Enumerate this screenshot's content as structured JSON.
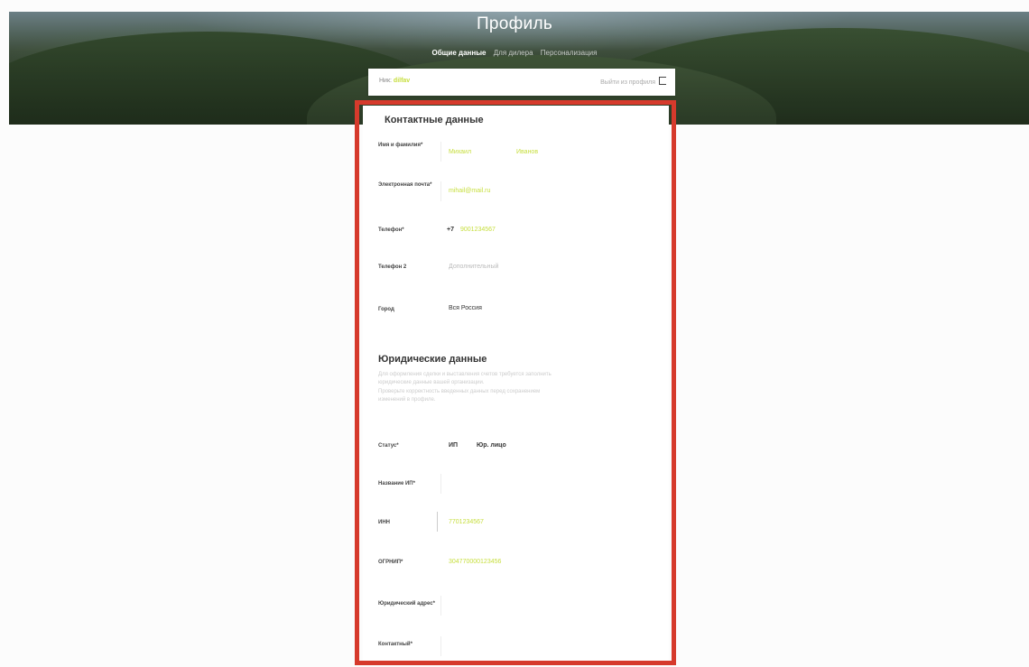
{
  "header": {
    "title": "Профиль",
    "tabs": [
      {
        "label": "Общие данные",
        "active": true
      },
      {
        "label": "Для дилера",
        "active": false
      },
      {
        "label": "Персонализация",
        "active": false
      }
    ]
  },
  "account": {
    "nick_prefix": "Ник: ",
    "nick_value": "dilfav",
    "logout_label": "Выйти из профиля"
  },
  "contact": {
    "title": "Контактные данные",
    "name_label": "Имя и фамилия*",
    "first_name": "Михаил",
    "last_name": "Иванов",
    "email_label": "Электронная почта*",
    "email": "mihail@mail.ru",
    "phone_label": "Телефон*",
    "phone_prefix": "+7",
    "phone": "9001234567",
    "extra_phone_label": "Телефон 2",
    "extra_phone_placeholder": "Дополнительный",
    "city_label": "Город",
    "city": "Вся Россия"
  },
  "legal": {
    "title": "Юридические данные",
    "note_1": "Для оформления сделки и выставления счетов требуется заполнить",
    "note_2": "юридические данные вашей организации.",
    "note_3": "Проверьте корректность введенных данных перед сохранением",
    "note_4": "изменений в профиле.",
    "status_label": "Статус*",
    "status_options": [
      "ИП",
      "Юр. лицо"
    ],
    "org_name_label": "Название ИП*",
    "inn_label": "ИНН",
    "inn": "7701234567",
    "ogrn_label": "ОГРНИП*",
    "ogrn": "304770000123456",
    "address_label": "Юридический адрес*",
    "contact_person_label": "Контактный*"
  },
  "colors": {
    "accent": "#c6de3c",
    "highlight": "#d63a2c"
  }
}
